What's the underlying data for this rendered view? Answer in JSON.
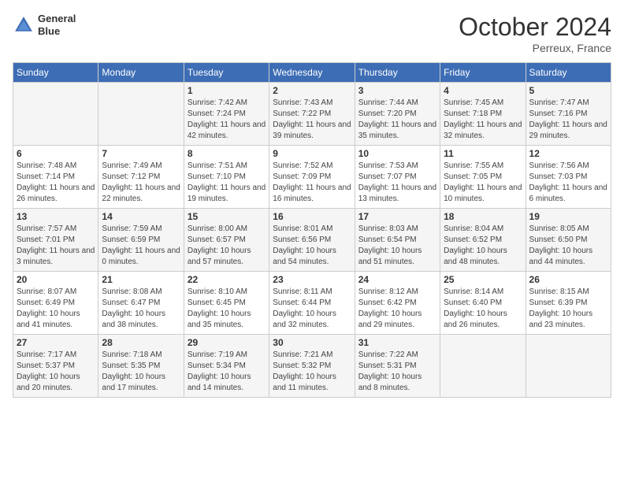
{
  "header": {
    "logo_line1": "General",
    "logo_line2": "Blue",
    "month": "October 2024",
    "location": "Perreux, France"
  },
  "days_of_week": [
    "Sunday",
    "Monday",
    "Tuesday",
    "Wednesday",
    "Thursday",
    "Friday",
    "Saturday"
  ],
  "weeks": [
    [
      {
        "day": "",
        "sunrise": "",
        "sunset": "",
        "daylight": ""
      },
      {
        "day": "",
        "sunrise": "",
        "sunset": "",
        "daylight": ""
      },
      {
        "day": "1",
        "sunrise": "Sunrise: 7:42 AM",
        "sunset": "Sunset: 7:24 PM",
        "daylight": "Daylight: 11 hours and 42 minutes."
      },
      {
        "day": "2",
        "sunrise": "Sunrise: 7:43 AM",
        "sunset": "Sunset: 7:22 PM",
        "daylight": "Daylight: 11 hours and 39 minutes."
      },
      {
        "day": "3",
        "sunrise": "Sunrise: 7:44 AM",
        "sunset": "Sunset: 7:20 PM",
        "daylight": "Daylight: 11 hours and 35 minutes."
      },
      {
        "day": "4",
        "sunrise": "Sunrise: 7:45 AM",
        "sunset": "Sunset: 7:18 PM",
        "daylight": "Daylight: 11 hours and 32 minutes."
      },
      {
        "day": "5",
        "sunrise": "Sunrise: 7:47 AM",
        "sunset": "Sunset: 7:16 PM",
        "daylight": "Daylight: 11 hours and 29 minutes."
      }
    ],
    [
      {
        "day": "6",
        "sunrise": "Sunrise: 7:48 AM",
        "sunset": "Sunset: 7:14 PM",
        "daylight": "Daylight: 11 hours and 26 minutes."
      },
      {
        "day": "7",
        "sunrise": "Sunrise: 7:49 AM",
        "sunset": "Sunset: 7:12 PM",
        "daylight": "Daylight: 11 hours and 22 minutes."
      },
      {
        "day": "8",
        "sunrise": "Sunrise: 7:51 AM",
        "sunset": "Sunset: 7:10 PM",
        "daylight": "Daylight: 11 hours and 19 minutes."
      },
      {
        "day": "9",
        "sunrise": "Sunrise: 7:52 AM",
        "sunset": "Sunset: 7:09 PM",
        "daylight": "Daylight: 11 hours and 16 minutes."
      },
      {
        "day": "10",
        "sunrise": "Sunrise: 7:53 AM",
        "sunset": "Sunset: 7:07 PM",
        "daylight": "Daylight: 11 hours and 13 minutes."
      },
      {
        "day": "11",
        "sunrise": "Sunrise: 7:55 AM",
        "sunset": "Sunset: 7:05 PM",
        "daylight": "Daylight: 11 hours and 10 minutes."
      },
      {
        "day": "12",
        "sunrise": "Sunrise: 7:56 AM",
        "sunset": "Sunset: 7:03 PM",
        "daylight": "Daylight: 11 hours and 6 minutes."
      }
    ],
    [
      {
        "day": "13",
        "sunrise": "Sunrise: 7:57 AM",
        "sunset": "Sunset: 7:01 PM",
        "daylight": "Daylight: 11 hours and 3 minutes."
      },
      {
        "day": "14",
        "sunrise": "Sunrise: 7:59 AM",
        "sunset": "Sunset: 6:59 PM",
        "daylight": "Daylight: 11 hours and 0 minutes."
      },
      {
        "day": "15",
        "sunrise": "Sunrise: 8:00 AM",
        "sunset": "Sunset: 6:57 PM",
        "daylight": "Daylight: 10 hours and 57 minutes."
      },
      {
        "day": "16",
        "sunrise": "Sunrise: 8:01 AM",
        "sunset": "Sunset: 6:56 PM",
        "daylight": "Daylight: 10 hours and 54 minutes."
      },
      {
        "day": "17",
        "sunrise": "Sunrise: 8:03 AM",
        "sunset": "Sunset: 6:54 PM",
        "daylight": "Daylight: 10 hours and 51 minutes."
      },
      {
        "day": "18",
        "sunrise": "Sunrise: 8:04 AM",
        "sunset": "Sunset: 6:52 PM",
        "daylight": "Daylight: 10 hours and 48 minutes."
      },
      {
        "day": "19",
        "sunrise": "Sunrise: 8:05 AM",
        "sunset": "Sunset: 6:50 PM",
        "daylight": "Daylight: 10 hours and 44 minutes."
      }
    ],
    [
      {
        "day": "20",
        "sunrise": "Sunrise: 8:07 AM",
        "sunset": "Sunset: 6:49 PM",
        "daylight": "Daylight: 10 hours and 41 minutes."
      },
      {
        "day": "21",
        "sunrise": "Sunrise: 8:08 AM",
        "sunset": "Sunset: 6:47 PM",
        "daylight": "Daylight: 10 hours and 38 minutes."
      },
      {
        "day": "22",
        "sunrise": "Sunrise: 8:10 AM",
        "sunset": "Sunset: 6:45 PM",
        "daylight": "Daylight: 10 hours and 35 minutes."
      },
      {
        "day": "23",
        "sunrise": "Sunrise: 8:11 AM",
        "sunset": "Sunset: 6:44 PM",
        "daylight": "Daylight: 10 hours and 32 minutes."
      },
      {
        "day": "24",
        "sunrise": "Sunrise: 8:12 AM",
        "sunset": "Sunset: 6:42 PM",
        "daylight": "Daylight: 10 hours and 29 minutes."
      },
      {
        "day": "25",
        "sunrise": "Sunrise: 8:14 AM",
        "sunset": "Sunset: 6:40 PM",
        "daylight": "Daylight: 10 hours and 26 minutes."
      },
      {
        "day": "26",
        "sunrise": "Sunrise: 8:15 AM",
        "sunset": "Sunset: 6:39 PM",
        "daylight": "Daylight: 10 hours and 23 minutes."
      }
    ],
    [
      {
        "day": "27",
        "sunrise": "Sunrise: 7:17 AM",
        "sunset": "Sunset: 5:37 PM",
        "daylight": "Daylight: 10 hours and 20 minutes."
      },
      {
        "day": "28",
        "sunrise": "Sunrise: 7:18 AM",
        "sunset": "Sunset: 5:35 PM",
        "daylight": "Daylight: 10 hours and 17 minutes."
      },
      {
        "day": "29",
        "sunrise": "Sunrise: 7:19 AM",
        "sunset": "Sunset: 5:34 PM",
        "daylight": "Daylight: 10 hours and 14 minutes."
      },
      {
        "day": "30",
        "sunrise": "Sunrise: 7:21 AM",
        "sunset": "Sunset: 5:32 PM",
        "daylight": "Daylight: 10 hours and 11 minutes."
      },
      {
        "day": "31",
        "sunrise": "Sunrise: 7:22 AM",
        "sunset": "Sunset: 5:31 PM",
        "daylight": "Daylight: 10 hours and 8 minutes."
      },
      {
        "day": "",
        "sunrise": "",
        "sunset": "",
        "daylight": ""
      },
      {
        "day": "",
        "sunrise": "",
        "sunset": "",
        "daylight": ""
      }
    ]
  ]
}
